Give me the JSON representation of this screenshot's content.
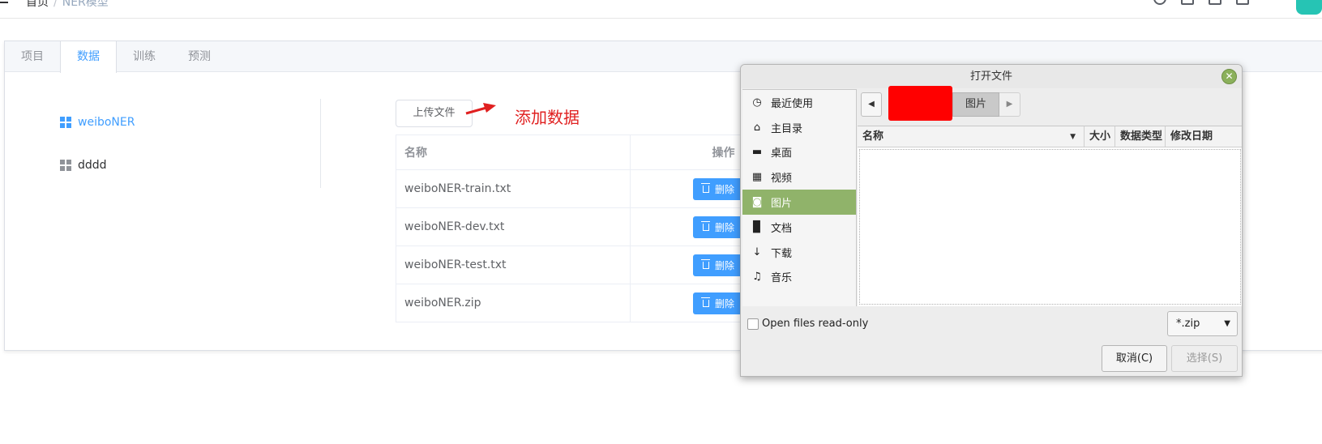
{
  "header": {
    "breadcrumb_home": "首页",
    "breadcrumb_sep": "/",
    "breadcrumb_current": "NER模型"
  },
  "tabs": [
    {
      "label": "项目",
      "active": false
    },
    {
      "label": "数据",
      "active": true
    },
    {
      "label": "训练",
      "active": false
    },
    {
      "label": "预测",
      "active": false
    }
  ],
  "projects": [
    {
      "label": "weiboNER",
      "active": true
    },
    {
      "label": "dddd",
      "active": false
    }
  ],
  "upload": {
    "label": "上传文件"
  },
  "annotation": {
    "text": "添加数据",
    "color": "#e02020"
  },
  "table": {
    "col_name": "名称",
    "col_ops": "操作",
    "delete_label": "删除",
    "rows": [
      {
        "name": "weiboNER-train.txt"
      },
      {
        "name": "weiboNER-dev.txt"
      },
      {
        "name": "weiboNER-test.txt"
      },
      {
        "name": "weiboNER.zip"
      }
    ]
  },
  "dialog": {
    "title": "打开文件",
    "close": "✕",
    "places": [
      {
        "icon": "clock-icon",
        "glyph": "◷",
        "label": "最近使用"
      },
      {
        "icon": "home-icon",
        "glyph": "⌂",
        "label": "主目录"
      },
      {
        "icon": "desktop-icon",
        "glyph": "▬",
        "label": "桌面"
      },
      {
        "icon": "film-icon",
        "glyph": "▦",
        "label": "视频"
      },
      {
        "icon": "camera-icon",
        "glyph": "◙",
        "label": "图片",
        "selected": true
      },
      {
        "icon": "document-icon",
        "glyph": "▉",
        "label": "文档"
      },
      {
        "icon": "download-icon",
        "glyph": "↓",
        "label": "下载"
      },
      {
        "icon": "music-icon",
        "glyph": "♫",
        "label": "音乐"
      }
    ],
    "path_current": "图片",
    "columns": {
      "name": "名称",
      "size": "大小",
      "type": "数据类型",
      "date": "修改日期"
    },
    "readonly_label": "Open files read-only",
    "filter_value": "*.zip",
    "cancel_label": "取消(C)",
    "choose_label": "选择(S)"
  },
  "colors": {
    "accent": "#409eff",
    "selection": "#90b36a",
    "redaction": "#ff0000"
  }
}
